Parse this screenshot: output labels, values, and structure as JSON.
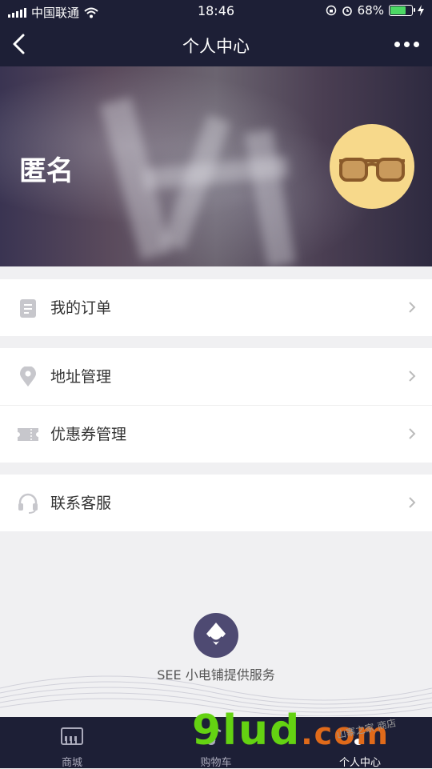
{
  "status_bar": {
    "carrier": "中国联通",
    "time": "18:46",
    "battery_percent": "68%",
    "battery_level": 0.68,
    "icons": [
      "signal-icon",
      "wifi-icon",
      "rotation-lock-icon",
      "alarm-icon",
      "battery-icon",
      "charging-icon"
    ]
  },
  "nav": {
    "title": "个人中心",
    "back_icon": "back-chevron-icon",
    "more_icon": "more-dots-icon"
  },
  "profile": {
    "name": "匿名",
    "avatar_icon": "sunglasses-avatar-icon"
  },
  "menu": {
    "groups": [
      [
        {
          "label": "我的订单",
          "icon": "order-list-icon"
        }
      ],
      [
        {
          "label": "地址管理",
          "icon": "location-pin-icon"
        },
        {
          "label": "优惠券管理",
          "icon": "coupon-icon"
        }
      ],
      [
        {
          "label": "联系客服",
          "icon": "headset-icon"
        }
      ]
    ]
  },
  "provider": {
    "text": "SEE 小电铺提供服务",
    "icon": "see-logo-icon"
  },
  "tabs": [
    {
      "label": "商城",
      "icon": "piano-icon",
      "active": false
    },
    {
      "label": "购物车",
      "icon": "music-note-icon",
      "active": false
    },
    {
      "label": "个人中心",
      "icon": "music-note-icon",
      "active": true
    }
  ],
  "watermark": {
    "text": "9lud",
    "suffix": ".com",
    "note": "山寨之家 商店"
  },
  "colors": {
    "header_bg": "#1d1f36",
    "page_bg": "#f0f0f2",
    "avatar_bg": "#f7d98b",
    "provider_logo": "#4e4a72"
  }
}
